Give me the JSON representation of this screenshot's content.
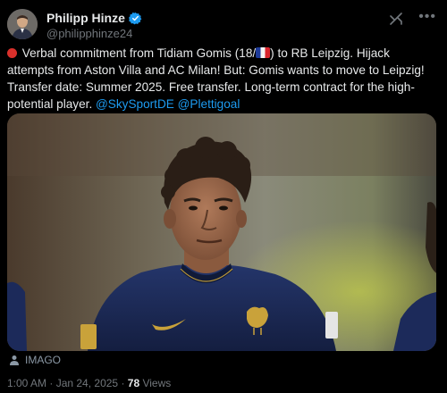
{
  "author": {
    "name": "Philipp Hinze",
    "handle": "@philipphinze24"
  },
  "icons": {
    "avatar": "avatar",
    "verified": "verified-badge-icon",
    "grok": "grok-icon",
    "more": "more-options-icon",
    "red_circle": "red-circle-emoji",
    "flag": "france-flag-emoji",
    "person": "person-icon"
  },
  "tweet": {
    "text_part1": " Verbal commitment from Tidiam Gomis (18/",
    "text_part2": ") to RB Leipzig. Hijack attempts from Aston Villa and AC Milan! But: Gomis wants to move to Leipzig! Transfer date: Summer 2025. Free transfer. Long-term contract for the high-potential player. ",
    "mention1": "@SkySportDE",
    "mention2": "@Plettigoal"
  },
  "media": {
    "credit": "IMAGO"
  },
  "footer": {
    "time": "1:00 AM",
    "separator1": " · ",
    "date": "Jan 24, 2025",
    "separator2": " · ",
    "views_count": "78",
    "views_label": " Views"
  },
  "colors": {
    "background": "#000000",
    "text": "#e7e9ea",
    "muted": "#71767b",
    "link": "#1d9bf0",
    "verified": "#1d9bf0",
    "jersey": "#1c2a5a"
  }
}
